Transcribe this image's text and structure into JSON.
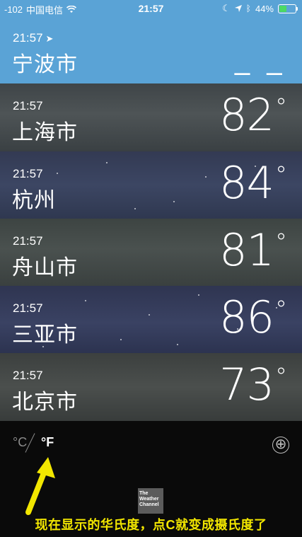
{
  "status_bar": {
    "signal": "-102",
    "carrier": "中国电信",
    "time": "21:57",
    "battery": "44%",
    "battery_level": 0.44,
    "colors": {
      "battery_fill": "#4cd964"
    }
  },
  "current": {
    "time": "21:57",
    "name": "宁波市",
    "temp": "– –",
    "color": "#5aa3d6"
  },
  "cities": [
    {
      "time": "21:57",
      "name": "上海市",
      "temp": "82"
    },
    {
      "time": "21:57",
      "name": "杭州",
      "temp": "84"
    },
    {
      "time": "21:57",
      "name": "舟山市",
      "temp": "81"
    },
    {
      "time": "21:57",
      "name": "三亚市",
      "temp": "86"
    },
    {
      "time": "21:57",
      "name": "北京市",
      "temp": "73"
    }
  ],
  "degree_symbol": "°",
  "units": {
    "celsius": "°C",
    "fahrenheit": "°F",
    "selected": "fahrenheit"
  },
  "add_button": "⊕",
  "logo_text": "The Weather Channel",
  "annotation": {
    "text": "现在显示的华氏度，点C就变成摄氏度了",
    "color": "#f2e600"
  }
}
